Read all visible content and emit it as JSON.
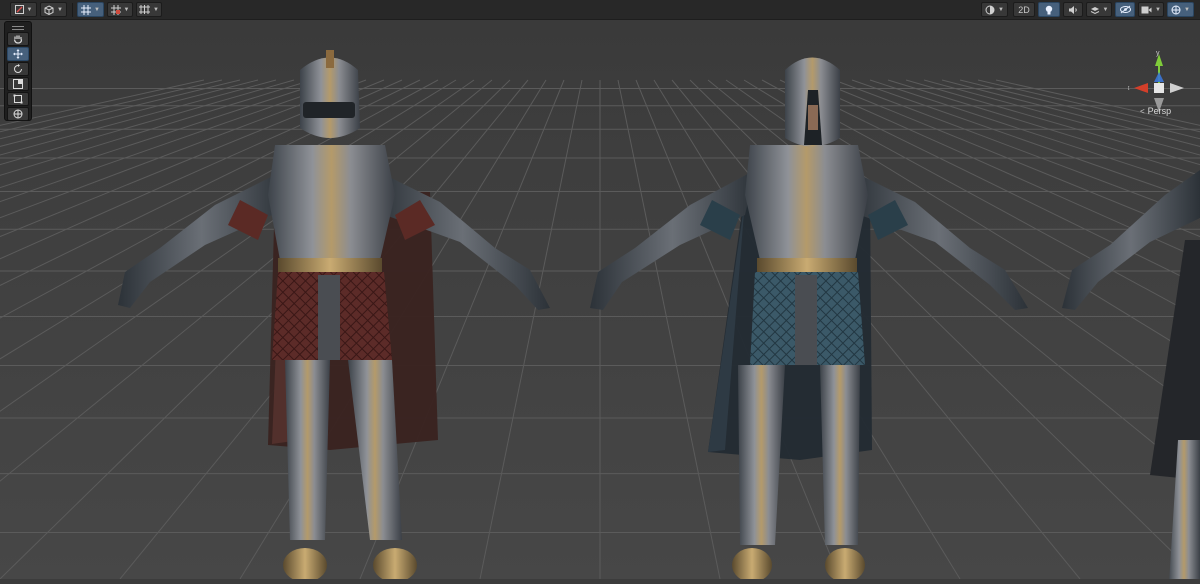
{
  "scene_toolbar": {
    "left": [
      {
        "name": "draw-mode-icon",
        "caret": "▾"
      },
      {
        "name": "shading-cube-icon",
        "caret": "▾"
      },
      {
        "name": "grid-snap-icon",
        "caret": "▾",
        "on": true
      },
      {
        "name": "increment-snap-icon",
        "caret": "▾"
      },
      {
        "name": "grid-visibility-icon",
        "caret": "▾"
      }
    ],
    "right": {
      "mode_2d_label": "2D"
    }
  },
  "tools": [
    "hand-tool-icon",
    "move-tool-icon",
    "rotate-tool-icon",
    "scale-tool-icon",
    "rect-tool-icon",
    "transform-tool-icon"
  ],
  "gizmo": {
    "axis_y": "y",
    "axis_x": "x",
    "projection_label": "Persp"
  },
  "colors": {
    "background": "#3c3c3c",
    "grid_line": "#5a5a5a",
    "gizmo_x": "#d33f2a",
    "gizmo_y": "#7fcc3a",
    "gizmo_z": "#3a74d6",
    "accent": "#46607c",
    "knight_left_cloth": "#5a2a26",
    "knight_right_cloth": "#2c4450"
  },
  "scene_objects": [
    "knight-red-tabard",
    "knight-blue-tabard",
    "knight-partial"
  ]
}
